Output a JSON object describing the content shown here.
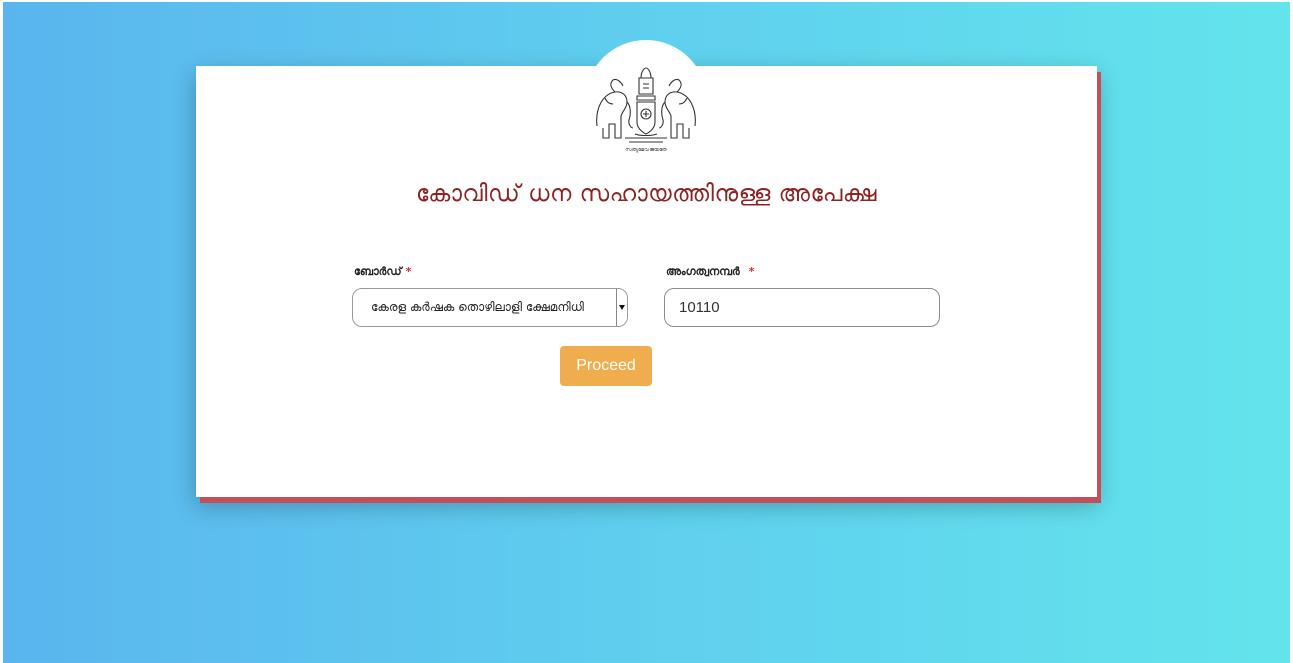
{
  "header": {
    "title": "കോവിഡ് ധന സഹായത്തിനുള്ള അപേക്ഷ",
    "emblem_text": "സത്യമേവ ജയതേ"
  },
  "form": {
    "board": {
      "label": "ബോർഡ്",
      "required_mark": "*",
      "selected_value": "കേരള കർഷക തൊഴിലാളി ക്ഷേമനിധി"
    },
    "membership": {
      "label": "അംഗത്വനമ്പർ",
      "required_mark": "*",
      "value": "10110"
    },
    "proceed_label": "Proceed"
  },
  "colors": {
    "background_start": "#5ab5ee",
    "background_end": "#63e4ec",
    "title": "#8b2323",
    "button": "#f0ad4e",
    "required": "#e3262f",
    "card_shadow": "#c2505b"
  },
  "icons": {
    "emblem": "kerala-state-emblem-icon",
    "dropdown": "caret-down-icon"
  }
}
